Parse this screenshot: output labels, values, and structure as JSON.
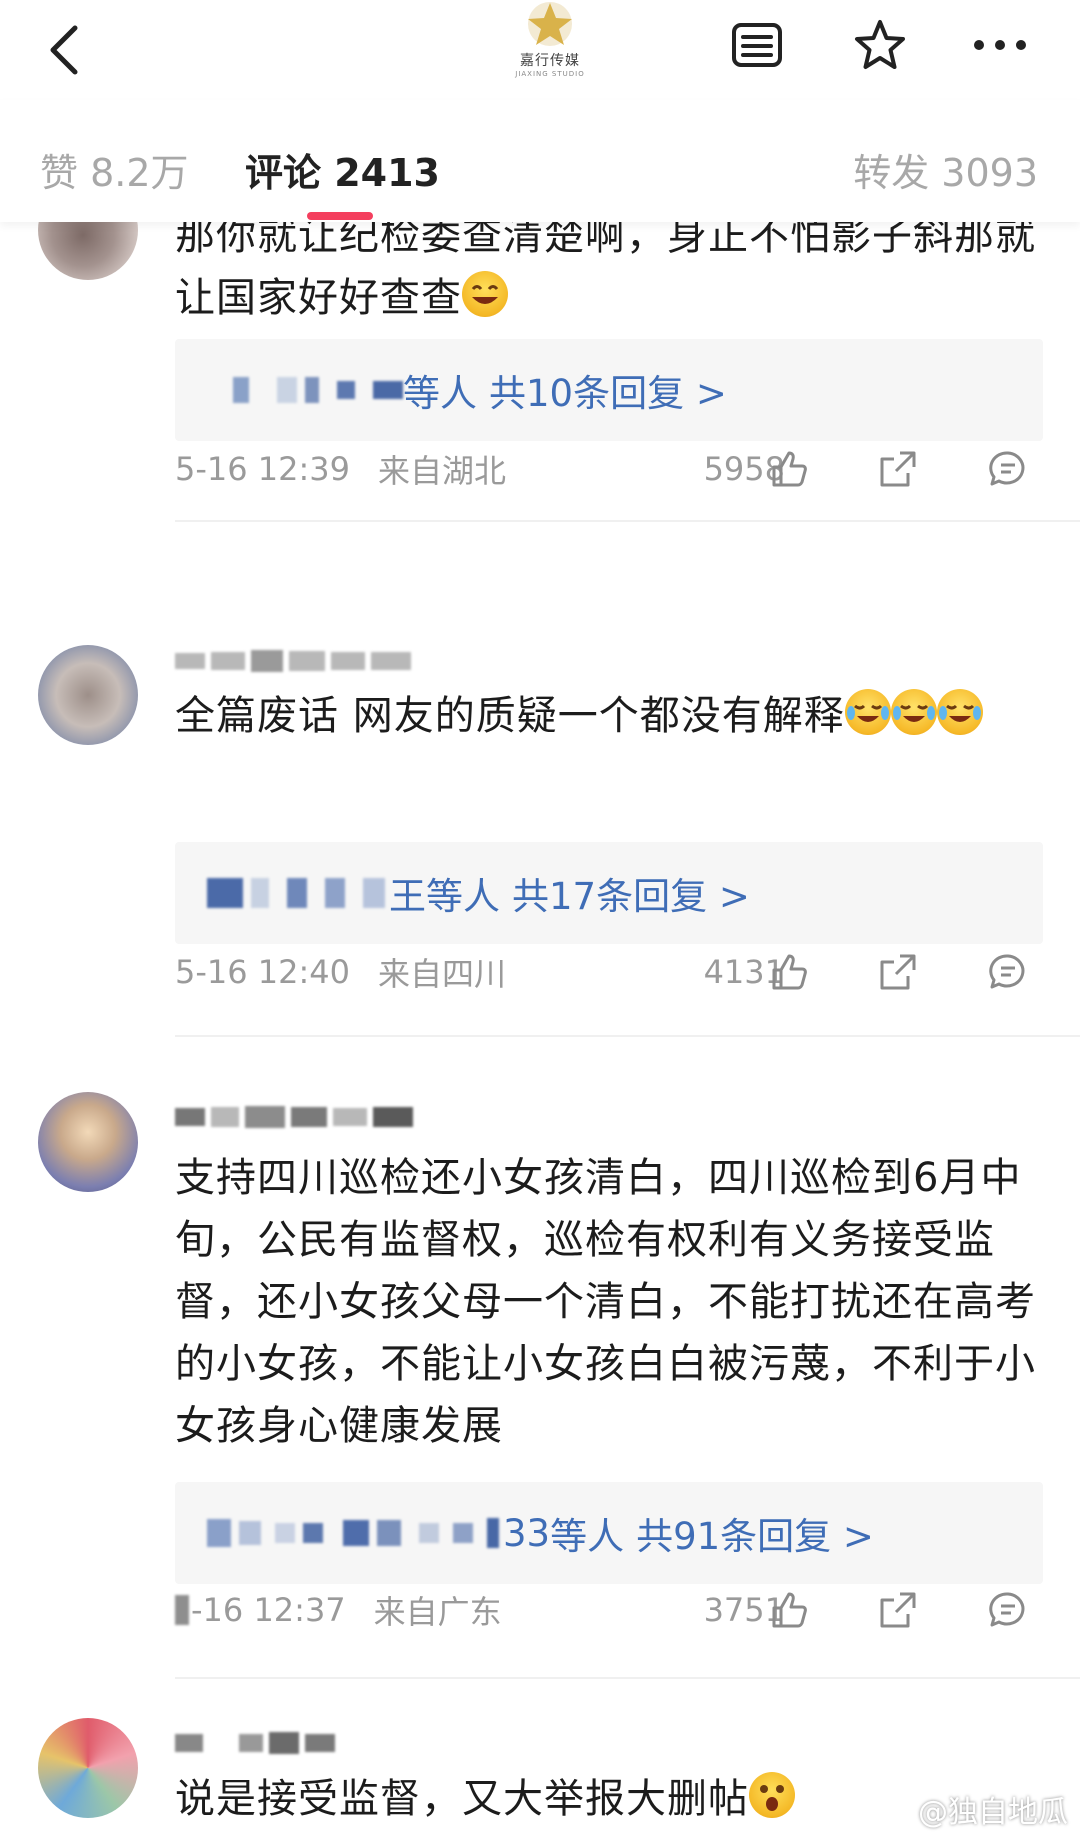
{
  "header": {
    "logo_text": "嘉行传媒",
    "logo_subtext": "JIAXING STUDIO"
  },
  "tabs": {
    "likes": "赞 8.2万",
    "comments": "评论 2413",
    "reposts": "转发 3093"
  },
  "comments": [
    {
      "text": "那你就让纪检委查清楚啊，身正不怕影子斜那就让国家好好查查",
      "emojis": [
        "laugh"
      ],
      "reply_suffix": "",
      "reply_etc": "等人",
      "reply_count": "共10条回复 >",
      "time": "5-16 12:39",
      "location": "来自湖北",
      "likes": "5958"
    },
    {
      "text": "全篇废话 网友的质疑一个都没有解释",
      "emojis": [
        "cry",
        "cry",
        "cry"
      ],
      "reply_suffix": "王",
      "reply_etc": "等人",
      "reply_count": "共17条回复 >",
      "time": "5-16 12:40",
      "location": "来自四川",
      "likes": "4131"
    },
    {
      "text": "支持四川巡检还小女孩清白，四川巡检到6月中旬，公民有监督权，巡检有权利有义务接受监督，还小女孩父母一个清白，不能打扰还在高考的小女孩，不能让小女孩白白被污蔑，不利于小女孩身心健康发展",
      "emojis": [],
      "reply_suffix": "33",
      "reply_etc": "等人",
      "reply_count": "共91条回复 >",
      "time": "-16 12:37",
      "location": "来自广东",
      "likes": "3751"
    },
    {
      "text": "说是接受监督，又大举报大删帖",
      "emojis": [
        "surprised"
      ]
    }
  ],
  "watermark": "@独自地瓜",
  "colors": {
    "accent_tab": "#f43f5e",
    "link_blue": "#3f6db6",
    "meta_gray": "#9a9a9a"
  },
  "icons": [
    "back-icon",
    "menu-icon",
    "star-icon",
    "more-icon",
    "like-icon",
    "share-icon",
    "reply-icon"
  ]
}
